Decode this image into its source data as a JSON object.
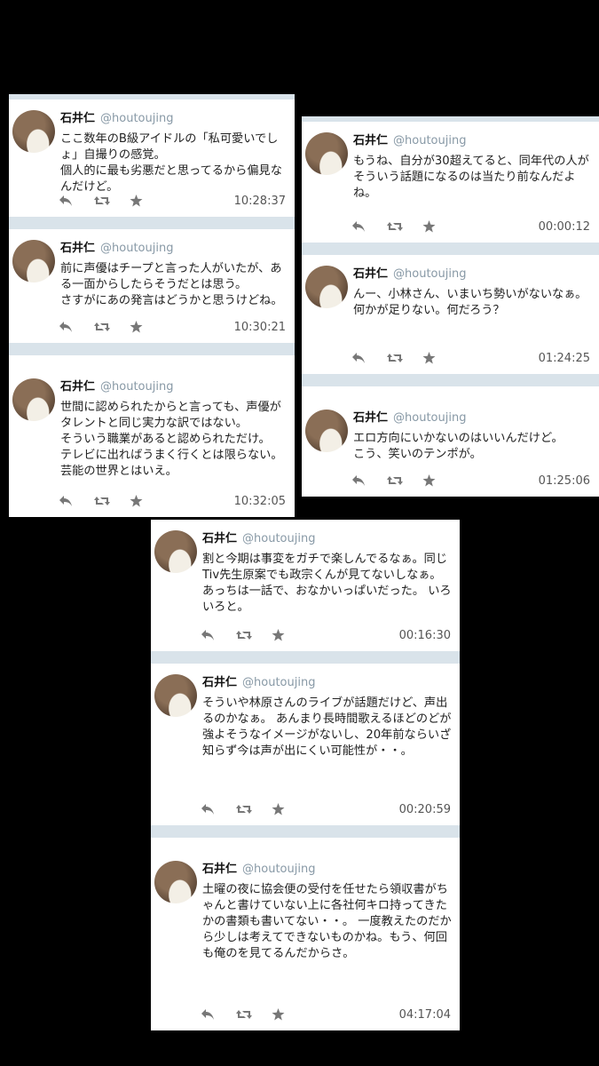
{
  "panels": [
    {
      "tweets": [
        {
          "name": "石井仁",
          "handle": "@houtoujing",
          "text": "ここ数年のB級アイドルの「私可愛いでしょ」自撮りの感覚。\n個人的に最も劣悪だと思ってるから偏見なんだけど。",
          "time": "10:28:37"
        },
        {
          "name": "石井仁",
          "handle": "@houtoujing",
          "text": "前に声優はチープと言った人がいたが、ある一面からしたらそうだとは思う。\nさすがにあの発言はどうかと思うけどね。",
          "time": "10:30:21"
        },
        {
          "name": "石井仁",
          "handle": "@houtoujing",
          "text": "世間に認められたからと言っても、声優がタレントと同じ実力な訳ではない。\nそういう職業があると認められただけ。\nテレビに出ればうまく行くとは限らない。\n芸能の世界とはいえ。",
          "time": "10:32:05"
        }
      ]
    },
    {
      "tweets": [
        {
          "name": "石井仁",
          "handle": "@houtoujing",
          "text": "もうね、自分が30超えてると、同年代の人がそういう話題になるのは当たり前なんだよね。",
          "time": "00:00:12"
        },
        {
          "name": "石井仁",
          "handle": "@houtoujing",
          "text": "んー、小林さん、いまいち勢いがないなぁ。\n何かが足りない。何だろう？",
          "time": "01:24:25"
        },
        {
          "name": "石井仁",
          "handle": "@houtoujing",
          "text": "エロ方向にいかないのはいいんだけど。\nこう、笑いのテンポが。",
          "time": "01:25:06"
        }
      ]
    },
    {
      "tweets": [
        {
          "name": "石井仁",
          "handle": "@houtoujing",
          "text": "割と今期は事変をガチで楽しんでるなぁ。同じTiv先生原案でも政宗くんが見てないしなぁ。 あっちは一話で、おなかいっぱいだった。 いろいろと。",
          "time": "00:16:30"
        },
        {
          "name": "石井仁",
          "handle": "@houtoujing",
          "text": "そういや林原さんのライブが話題だけど、声出るのかなぁ。 あんまり長時間歌えるほどのどが強よそうなイメージがないし、20年前ならいざ知らず今は声が出にくい可能性が・・。",
          "time": "00:20:59"
        },
        {
          "name": "石井仁",
          "handle": "@houtoujing",
          "text": "土曜の夜に協会便の受付を任せたら領収書がちゃんと書けていない上に各社何キロ持ってきたかの書類も書いてない・・。 一度教えたのだから少しは考えてできないものかね。もう、何回も俺のを見てるんだからさ。",
          "time": "04:17:04"
        }
      ]
    }
  ],
  "icons": [
    "reply-icon",
    "retweet-icon",
    "favorite-icon"
  ],
  "colors": {
    "separator": "#d9e3ea",
    "handle": "#8899a6",
    "background": "#000000"
  }
}
